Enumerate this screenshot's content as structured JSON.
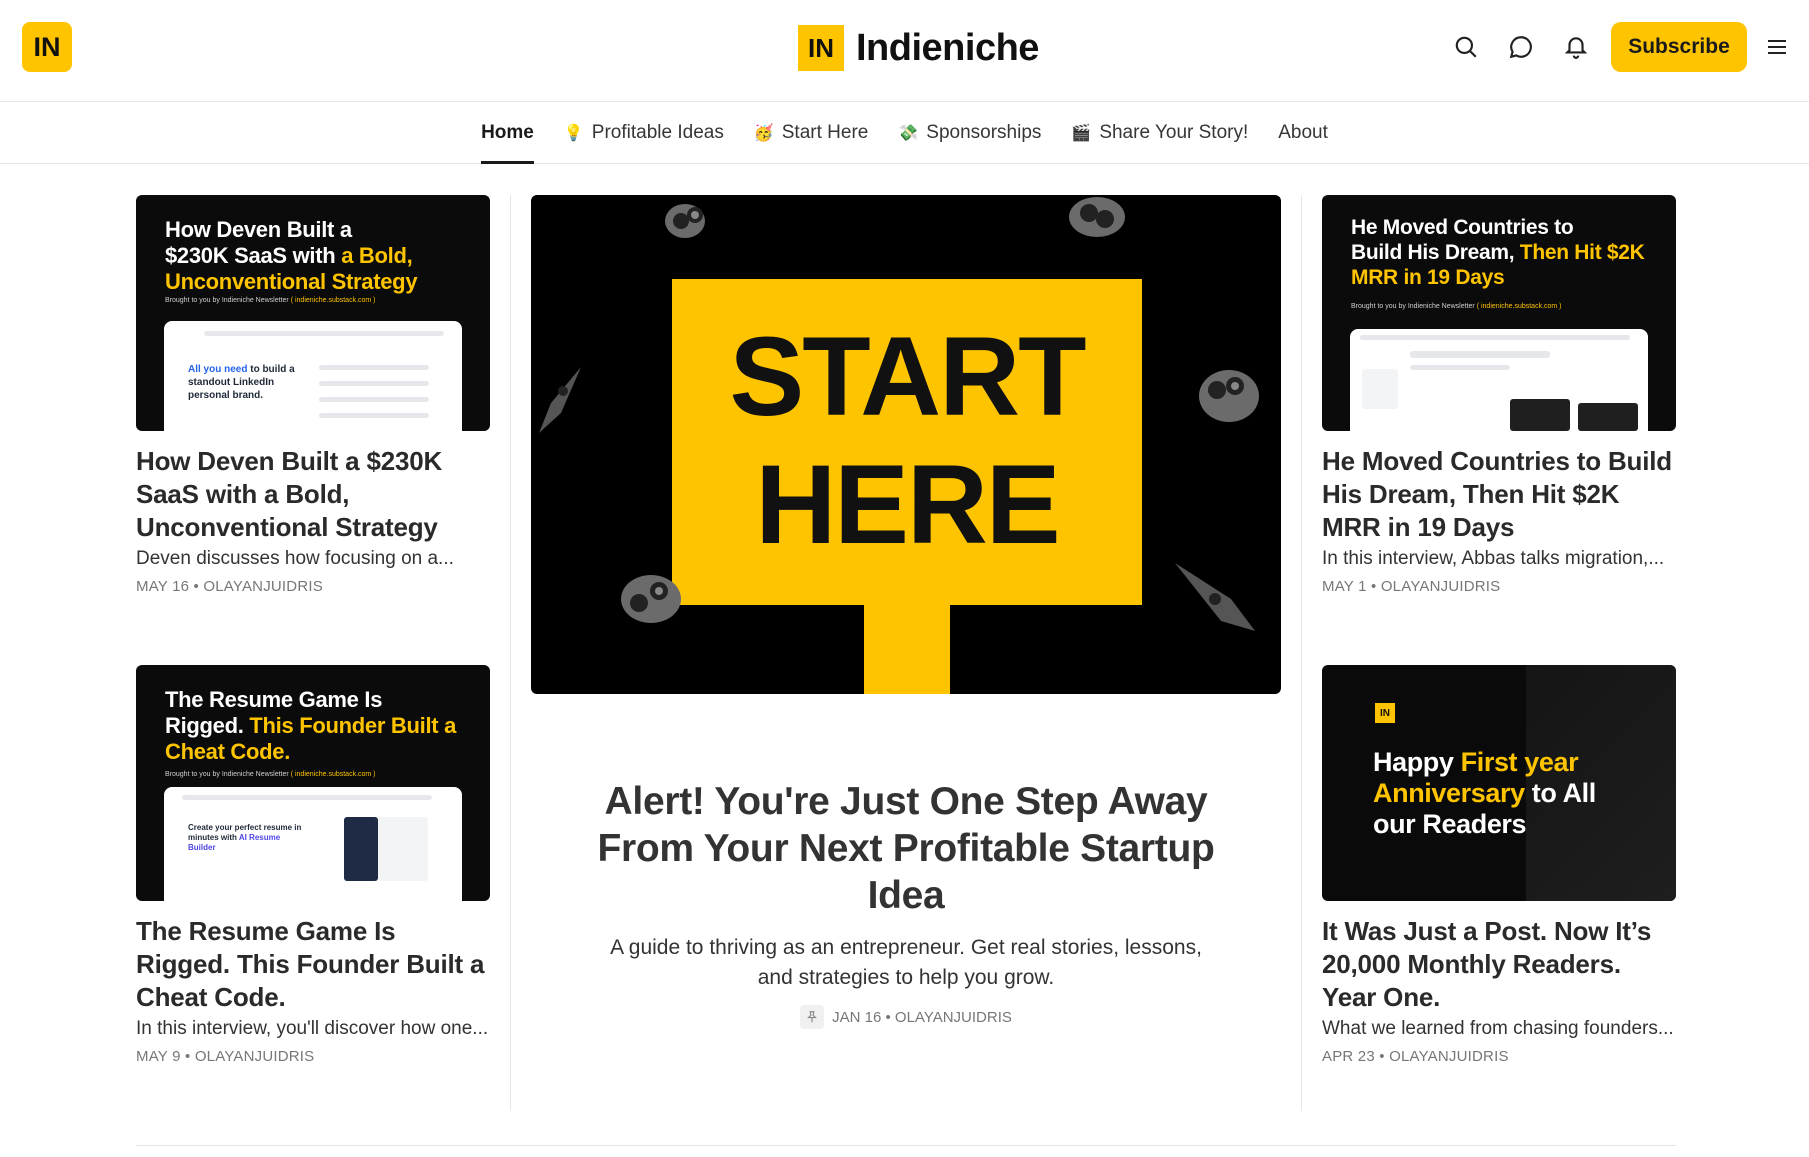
{
  "header": {
    "logo_text": "IN",
    "brand_badge": "IN",
    "brand_name": "Indieniche",
    "subscribe_label": "Subscribe",
    "icons": [
      "search-icon",
      "chat-icon",
      "bell-icon",
      "menu-icon"
    ],
    "accent_color": "#FFC400"
  },
  "nav": {
    "items": [
      {
        "label": "Home",
        "emoji": "",
        "active": true
      },
      {
        "label": "Profitable Ideas",
        "emoji": "💡"
      },
      {
        "label": "Start Here",
        "emoji": "🥳"
      },
      {
        "label": "Sponsorships",
        "emoji": "💸"
      },
      {
        "label": "Share Your Story!",
        "emoji": "🎬"
      },
      {
        "label": "About",
        "emoji": ""
      }
    ]
  },
  "posts": {
    "left_top": {
      "thumb_title_a": "How Deven Built a",
      "thumb_title_b": "$230K SaaS with",
      "thumb_title_hl": "a Bold, Unconventional Strategy",
      "thumb_sub": "Brought to you by Indieniche Newsletter",
      "thumb_sub_link": "( indieniche.substack.com )",
      "mock_text_hl": "All you need",
      "mock_text": "to build a standout LinkedIn personal brand.",
      "title": "How Deven Built a $230K SaaS with a Bold, Unconventional Strategy",
      "desc": "Deven discusses how focusing on a...",
      "meta": "MAY 16 • OLAYANJUIDRIS"
    },
    "left_bottom": {
      "thumb_title_a": "The Resume Game Is",
      "thumb_title_b": "Rigged.",
      "thumb_title_hl": "This Founder Built a Cheat Code.",
      "thumb_sub": "Brought to you by Indieniche Newsletter",
      "thumb_sub_link": "( indieniche.substack.com )",
      "mock_text": "Create your perfect resume in minutes with",
      "mock_text_hl": "AI Resume Builder",
      "title": "The Resume Game Is Rigged. This Founder Built a Cheat Code.",
      "desc": "In this interview, you'll discover how one...",
      "meta": "MAY 9 • OLAYANJUIDRIS"
    },
    "right_top": {
      "thumb_title_a": "He Moved Countries to",
      "thumb_title_b": "Build His Dream,",
      "thumb_title_hl": "Then Hit $2K MRR in 19 Days",
      "thumb_sub": "Brought to you by Indieniche Newsletter",
      "thumb_sub_link": "( indieniche.substack.com )",
      "title": "He Moved Countries to Build His Dream, Then Hit $2K MRR in 19 Days",
      "desc": "In this interview, Abbas talks migration,...",
      "meta": "MAY 1 • OLAYANJUIDRIS"
    },
    "right_bottom": {
      "thumb_badge": "IN",
      "thumb_title_a": "Happy",
      "thumb_title_hl": "First year Anniversary",
      "thumb_title_b": "to All our Readers",
      "title": "It Was Just a Post. Now It’s 20,000 Monthly Readers. Year One.",
      "desc": "What we learned from chasing founders...",
      "meta": "APR 23 • OLAYANJUIDRIS"
    },
    "feature": {
      "sign_line1": "START",
      "sign_line2": "HERE",
      "title": "Alert! You're Just One Step Away From Your Next Profitable Startup Idea",
      "desc": "A guide to thriving as an entrepreneur. Get real stories, lessons, and strategies to help you grow.",
      "meta": "JAN 16 • OLAYANJUIDRIS",
      "pinned_icon": "pin-icon"
    }
  }
}
